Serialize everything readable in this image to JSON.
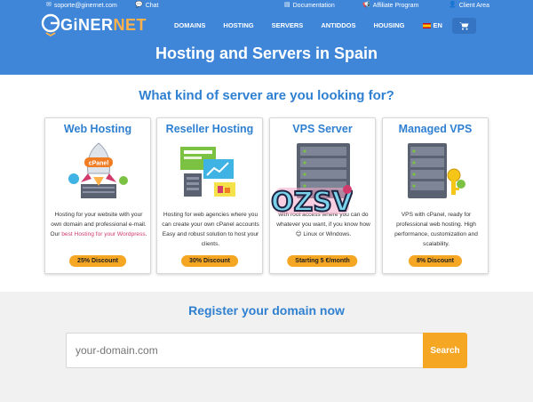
{
  "topbar": {
    "email": "soporte@ginernet.com",
    "chat": "Chat",
    "documentation": "Documentation",
    "affiliate": "Affiliate Program",
    "client_area": "Client Area"
  },
  "logo": {
    "brand_prefix": "GiNER",
    "brand_suffix": "NET"
  },
  "nav": {
    "items": [
      "DOMAINS",
      "HOSTING",
      "SERVERS",
      "ANTIDDOS",
      "HOUSING"
    ],
    "language": "EN"
  },
  "hero": {
    "title": "Hosting and Servers in Spain"
  },
  "servers": {
    "heading": "What kind of server are you looking for?",
    "cards": [
      {
        "title": "Web Hosting",
        "desc_before": "Hosting for your website with your own domain and professional e-mail. Our ",
        "desc_link": "best Hosting for your Wordpress",
        "desc_after": ".",
        "badge": "25% Discount",
        "art_label": "cPanel"
      },
      {
        "title": "Reseller Hosting",
        "desc_before": "Hosting for web agencies where you can create your own cPanel accounts Easy and robust solution to host your clients.",
        "desc_link": "",
        "desc_after": "",
        "badge": "30% Discount"
      },
      {
        "title": "VPS Server",
        "desc_before": "with root access where you can do whatever you want, if you know how 😊 Linux or Windows.",
        "desc_link": "",
        "desc_after": "",
        "badge": "Starting 5 €/month"
      },
      {
        "title": "Managed VPS",
        "desc_before": "VPS with cPanel, ready for professional web hosting. High performance, customization and scalability.",
        "desc_link": "",
        "desc_after": "",
        "badge": "8% Discount"
      }
    ],
    "sticker_text": "OZSV"
  },
  "domain": {
    "heading": "Register your domain now",
    "placeholder": "your-domain.com",
    "button": "Search"
  },
  "colors": {
    "header_bg": "#3f86d9",
    "accent_blue": "#2f80d1",
    "accent_orange": "#f5a623",
    "link_pink": "#d23b6b"
  }
}
